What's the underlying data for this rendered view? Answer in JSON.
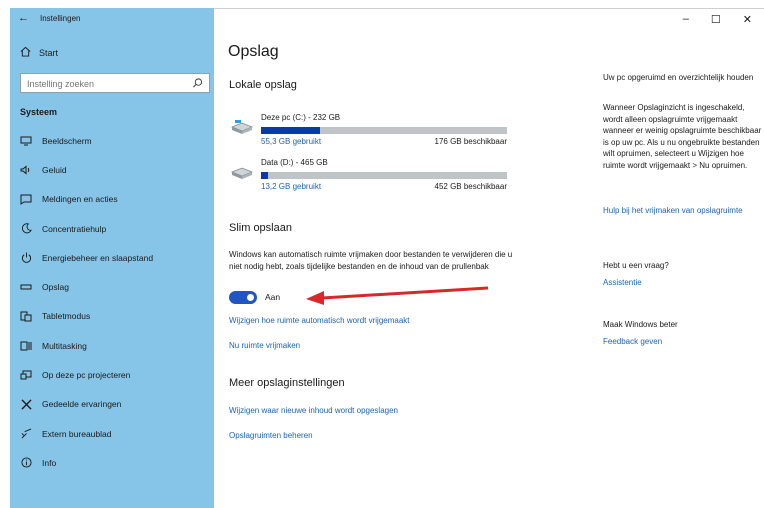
{
  "sidebar": {
    "back_icon": "back-arrow-icon",
    "title": "Instellingen",
    "start": "Start",
    "search_placeholder": "Instelling zoeken",
    "section": "Systeem",
    "items": [
      {
        "label": "Beeldscherm",
        "icon": "monitor-icon"
      },
      {
        "label": "Geluid",
        "icon": "speaker-icon"
      },
      {
        "label": "Meldingen en acties",
        "icon": "notification-icon"
      },
      {
        "label": "Concentratiehulp",
        "icon": "moon-icon"
      },
      {
        "label": "Energiebeheer en slaapstand",
        "icon": "power-icon"
      },
      {
        "label": "Opslag",
        "icon": "storage-icon"
      },
      {
        "label": "Tabletmodus",
        "icon": "tablet-icon"
      },
      {
        "label": "Multitasking",
        "icon": "multitasking-icon"
      },
      {
        "label": "Op deze pc projecteren",
        "icon": "project-icon"
      },
      {
        "label": "Gedeelde ervaringen",
        "icon": "shared-icon"
      },
      {
        "label": "Extern bureaublad",
        "icon": "remote-desktop-icon"
      },
      {
        "label": "Info",
        "icon": "info-icon"
      }
    ]
  },
  "window": {
    "minimize": "–",
    "maximize": "☐",
    "close": "✕"
  },
  "main": {
    "title": "Opslag",
    "local_heading": "Lokale opslag",
    "drives": [
      {
        "name": "Deze pc (C:) - 232 GB",
        "used": "55,3 GB gebruikt",
        "available": "176 GB beschikbaar",
        "used_fraction": 0.24
      },
      {
        "name": "Data (D:) - 465 GB",
        "used": "13,2 GB gebruikt",
        "available": "452 GB beschikbaar",
        "used_fraction": 0.03
      }
    ],
    "smart_heading": "Slim opslaan",
    "smart_desc": "Windows kan automatisch ruimte vrijmaken door bestanden te verwijderen die u niet nodig hebt, zoals tijdelijke bestanden en de inhoud van de prullenbak",
    "toggle_label": "Aan",
    "link_change": "Wijzigen hoe ruimte automatisch wordt vrijgemaakt",
    "link_free": "Nu ruimte vrijmaken",
    "more_heading": "Meer opslaginstellingen",
    "link_new_content": "Wijzigen waar nieuwe inhoud wordt opgeslagen",
    "link_manage": "Opslagruimten beheren"
  },
  "right": {
    "heading": "Uw pc opgeruimd en overzichtelijk houden",
    "body": "Wanneer Opslaginzicht is ingeschakeld, wordt alleen opslagruimte vrijgemaakt wanneer er weinig opslagruimte beschikbaar is op uw pc. Als u nu ongebruikte bestanden wilt opruimen, selecteert u Wijzigen hoe ruimte wordt vrijgemaakt > Nu opruimen.",
    "help_link": "Hulp bij het vrijmaken van opslagruimte",
    "question_heading": "Hebt u een vraag?",
    "question_link": "Assistentie",
    "better_heading": "Maak Windows beter",
    "feedback_link": "Feedback geven"
  },
  "colors": {
    "sidebar": "#86c5e8",
    "accent": "#1f56c4",
    "link": "#1c63b4",
    "arrow": "#d42a2a"
  }
}
